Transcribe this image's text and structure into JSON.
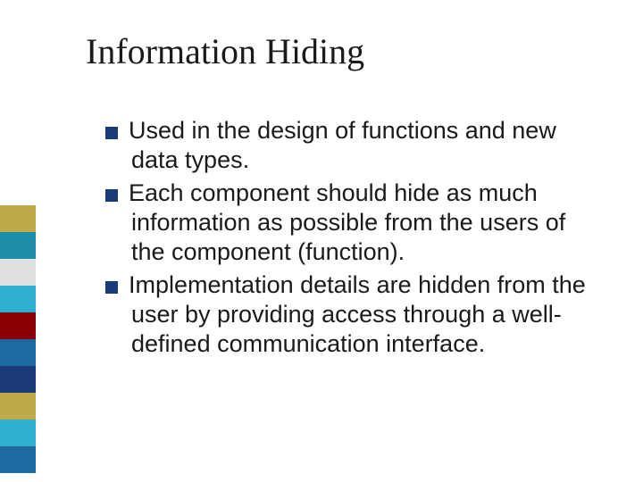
{
  "title": "Information Hiding",
  "bullets": {
    "b1": "Used in the design of functions and new data types.",
    "b2": "Each component should hide as much information as possible from the users of the component (function).",
    "b3": "Implementation details are hidden from the user by providing access through a well-defined communication interface."
  },
  "sidebar_colors": [
    "#bfa94a",
    "#1c8ea8",
    "#e0e0e0",
    "#30b0d0",
    "#8a0000",
    "#1c6aa0",
    "#1a3a7a",
    "#bfa94a",
    "#30b0d0",
    "#1c6aa0"
  ]
}
